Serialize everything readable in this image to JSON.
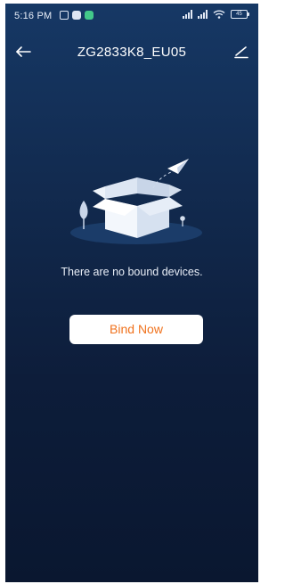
{
  "status_bar": {
    "time": "5:16 PM",
    "battery": "45",
    "notification_icons": [
      "sim-icon",
      "messenger-icon",
      "app-icon"
    ],
    "system_icons": [
      "signal-icon",
      "signal-icon",
      "wifi-icon",
      "battery-icon"
    ]
  },
  "nav": {
    "title": "ZG2833K8_EU05",
    "back_icon": "arrow-left-icon",
    "edit_icon": "pencil-icon"
  },
  "empty_state": {
    "message": "There are no bound devices.",
    "illustration": "open-box-with-paper-plane"
  },
  "actions": {
    "bind_label": "Bind Now"
  },
  "colors": {
    "background_top": "#163865",
    "background_bottom": "#0a1730",
    "button_bg": "#ffffff",
    "button_text": "#f0721d"
  }
}
